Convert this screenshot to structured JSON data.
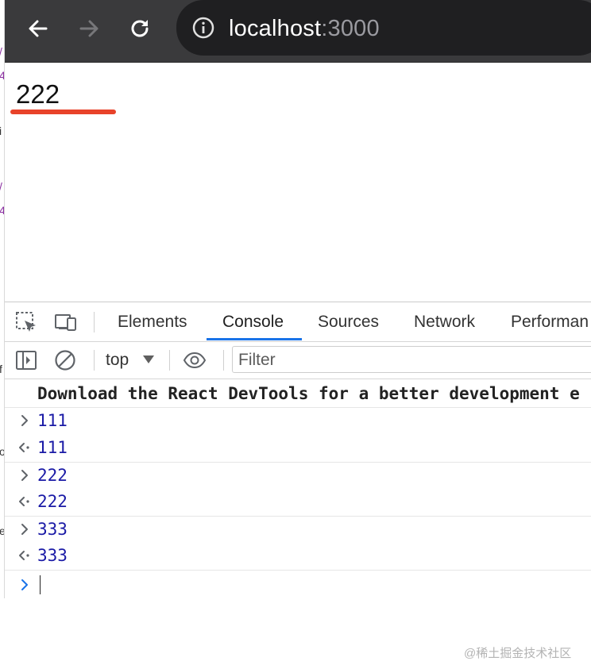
{
  "browser": {
    "url_host": "localhost",
    "url_port": ":3000"
  },
  "page": {
    "value": "222"
  },
  "devtools": {
    "tabs": [
      "Elements",
      "Console",
      "Sources",
      "Network",
      "Performan"
    ],
    "active_tab": "Console",
    "context": "top",
    "filter_placeholder": "Filter",
    "message": "Download the React DevTools for a better development e",
    "entries": [
      {
        "kind": "input",
        "value": "111"
      },
      {
        "kind": "output",
        "value": "111"
      },
      {
        "kind": "input",
        "value": "222"
      },
      {
        "kind": "output",
        "value": "222"
      },
      {
        "kind": "input",
        "value": "333"
      },
      {
        "kind": "output",
        "value": "333"
      }
    ]
  },
  "watermark": "@稀土掘金技术社区"
}
